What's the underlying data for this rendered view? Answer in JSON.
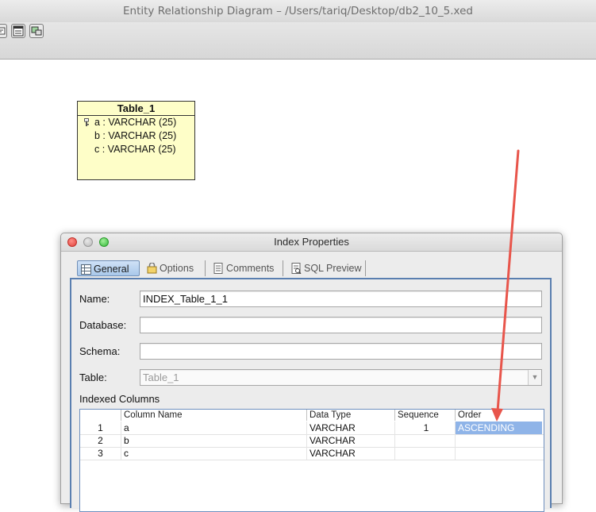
{
  "window": {
    "title": "Entity Relationship Diagram – /Users/tariq/Desktop/db2_10_5.xed"
  },
  "entity": {
    "title": "Table_1",
    "columns": [
      {
        "text": "a : VARCHAR (25)",
        "key": true
      },
      {
        "text": "b : VARCHAR (25)",
        "key": false
      },
      {
        "text": "c : VARCHAR (25)",
        "key": false
      }
    ]
  },
  "dialog": {
    "title": "Index Properties",
    "tabs": [
      "General",
      "Options",
      "Comments",
      "SQL Preview"
    ],
    "active_tab": "General",
    "fields": {
      "name_label": "Name:",
      "name_value": "INDEX_Table_1_1",
      "database_label": "Database:",
      "database_value": "",
      "schema_label": "Schema:",
      "schema_value": "",
      "table_label": "Table:",
      "table_value": "Table_1"
    },
    "indexed_columns_label": "Indexed Columns",
    "grid": {
      "headers": [
        "",
        "Column Name",
        "Data Type",
        "Sequence",
        "Order"
      ],
      "rows": [
        {
          "num": "1",
          "column": "a",
          "type": "VARCHAR",
          "sequence": "1",
          "order": "ASCENDING"
        },
        {
          "num": "2",
          "column": "b",
          "type": "VARCHAR",
          "sequence": "",
          "order": ""
        },
        {
          "num": "3",
          "column": "c",
          "type": "VARCHAR",
          "sequence": "",
          "order": ""
        }
      ]
    }
  },
  "colors": {
    "entity_fill": "#fefec8",
    "selection": "#8fb4e8",
    "annotation_arrow": "#e8554b",
    "tab_active": "#a9c8ea"
  },
  "icons": [
    "key-icon",
    "general-tab-icon",
    "options-tab-icon",
    "comments-tab-icon",
    "sql-preview-tab-icon",
    "dropdown-arrow-icon"
  ]
}
